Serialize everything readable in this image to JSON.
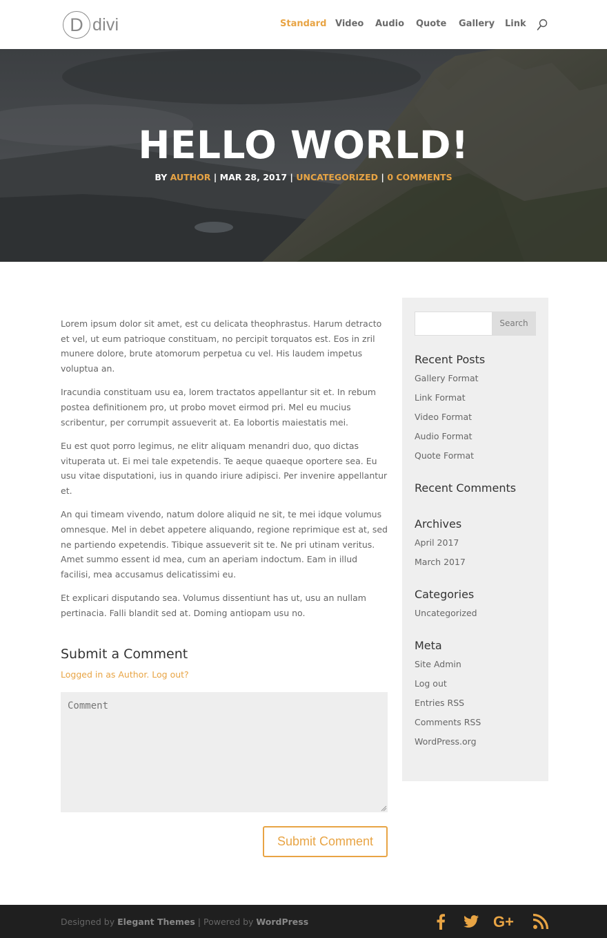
{
  "header": {
    "logo_text": "divi",
    "logo_letter": "D",
    "nav": [
      "Standard",
      "Video",
      "Audio",
      "Quote",
      "Gallery",
      "Link"
    ]
  },
  "hero": {
    "title": "HELLO WORLD!",
    "meta": {
      "by": "BY",
      "author": "AUTHOR",
      "sep": "|",
      "date": "MAR 28, 2017",
      "category": "UNCATEGORIZED",
      "comments": "0 COMMENTS"
    }
  },
  "content": {
    "paragraphs": [
      "Lorem ipsum dolor sit amet, est cu delicata theophrastus. Harum detracto et vel, ut eum patrioque constituam, no percipit torquatos est. Eos in zril munere dolore, brute atomorum perpetua cu vel. His laudem impetus voluptua an.",
      "Iracundia constituam usu ea, lorem tractatos appellantur sit et. In rebum postea definitionem pro, ut probo movet eirmod pri. Mel eu mucius scribentur, per corrumpit assueverit at. Ea lobortis maiestatis mei.",
      "Eu est quot porro legimus, ne elitr aliquam menandri duo, quo dictas vituperata ut. Ei mei tale expetendis. Te aeque quaeque oportere sea. Eu usu vitae disputationi, ius in quando iriure adipisci. Per invenire appellantur et.",
      "An qui timeam vivendo, natum dolore aliquid ne sit, te mei idque volumus omnesque. Mel in debet appetere aliquando, regione reprimique est at, sed ne partiendo expetendis. Tibique assueverit sit te. Ne pri utinam veritus. Amet summo essent id mea, cum an aperiam indoctum. Eam in illud facilisi, mea accusamus delicatissimi eu.",
      "Et explicari disputando sea. Volumus dissentiunt has ut, usu an nullam pertinacia. Falli blandit sed at. Doming antiopam usu no."
    ]
  },
  "comment_form": {
    "title": "Submit a Comment",
    "logged_in_text": "Logged in as Author",
    "separator": ". ",
    "logout": "Log out?",
    "placeholder": "Comment",
    "submit_label": "Submit Comment"
  },
  "sidebar": {
    "search_button": "Search",
    "recent_posts_title": "Recent Posts",
    "recent_posts": [
      "Gallery Format",
      "Link Format",
      "Video Format",
      "Audio Format",
      "Quote Format"
    ],
    "recent_comments_title": "Recent Comments",
    "archives_title": "Archives",
    "archives": [
      "April 2017",
      "March 2017"
    ],
    "categories_title": "Categories",
    "categories": [
      "Uncategorized"
    ],
    "meta_title": "Meta",
    "meta": [
      "Site Admin",
      "Log out",
      "Entries RSS",
      "Comments RSS",
      "WordPress.org"
    ]
  },
  "footer": {
    "designed_by": "Designed by ",
    "elegant": "Elegant Themes",
    "powered_by": " | Powered by ",
    "wordpress": "WordPress",
    "social_icons": [
      "facebook-icon",
      "twitter-icon",
      "google-plus-icon",
      "rss-icon"
    ]
  },
  "colors": {
    "accent": "#e8a444",
    "footer_bg": "#1f1f1f",
    "sidebar_bg": "#efefef"
  }
}
